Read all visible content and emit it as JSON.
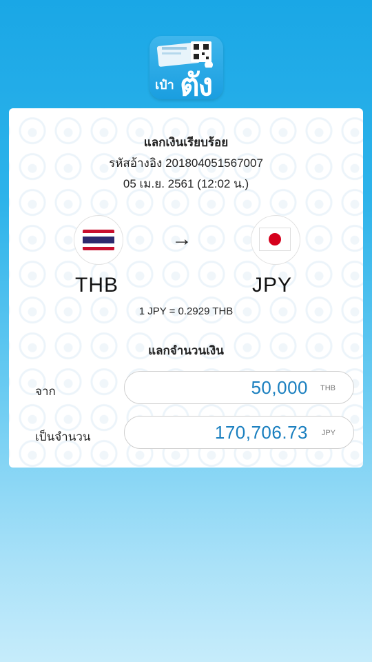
{
  "app": {
    "logo_small": "เป๋า",
    "logo_big": "ตัง",
    "logo_icon": "wallet-cards-icon"
  },
  "receipt": {
    "title": "แลกเงินเรียบร้อย",
    "reference": "รหัสอ้างอิง 201804051567007",
    "datetime": "05 เม.ย. 2561 (12:02 น.)"
  },
  "exchange": {
    "from_code": "THB",
    "to_code": "JPY",
    "from_flag_icon": "thailand-flag-icon",
    "to_flag_icon": "japan-flag-icon",
    "arrow_icon": "arrow-right-icon",
    "rate": "1 JPY = 0.2929 THB",
    "section_title": "แลกจำนวนเงิน"
  },
  "amounts": {
    "from_label": "จาก",
    "from_value": "50,000",
    "from_currency": "THB",
    "to_label": "เป็นจำนวน",
    "to_value": "170,706.73",
    "to_currency": "JPY"
  },
  "colors": {
    "background_top": "#1aa7e6",
    "amount_text": "#1a7fbf",
    "thai_red": "#c8102e",
    "thai_blue": "#2d2a6e",
    "japan_red": "#d5001c"
  }
}
